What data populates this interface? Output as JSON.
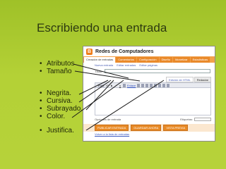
{
  "slide": {
    "title": "Escribiendo una entrada",
    "bullets": [
      "Atributos",
      "Tamaño",
      "Negrita.",
      "Cursiva.",
      "Subrayado.",
      "Color.",
      "Justifica."
    ]
  },
  "blogger": {
    "blog_name": "Redes de Computadores",
    "logo_letter": "B",
    "tabs": [
      "Creación de entradas",
      "Comentarios",
      "Configuración",
      "Diseño",
      "Monetizar",
      "Estadísticas"
    ],
    "subtabs": [
      "Nueva entrada",
      "Editar entradas",
      "Editar páginas"
    ],
    "title_label": "Título:",
    "mode_tabs": [
      "Edición de HTML",
      "Redactar"
    ],
    "toolbar": {
      "font": "Font",
      "size": "tT",
      "bold": "b",
      "italic": "i",
      "underline": "u",
      "link": "Enlace"
    },
    "options_label": "Opciones de entrada",
    "labels_label": "Etiquetas:",
    "buttons": [
      "PUBLICAR ENTRADA",
      "GUARDAR AHORA",
      "VISTA PREVIA"
    ],
    "back_link": "Volver a la lista de entradas"
  },
  "colors": {
    "background": "#b4d136",
    "title": "#2d3a10",
    "accent": "#e88a26",
    "pointer": "#1a1a1a"
  }
}
